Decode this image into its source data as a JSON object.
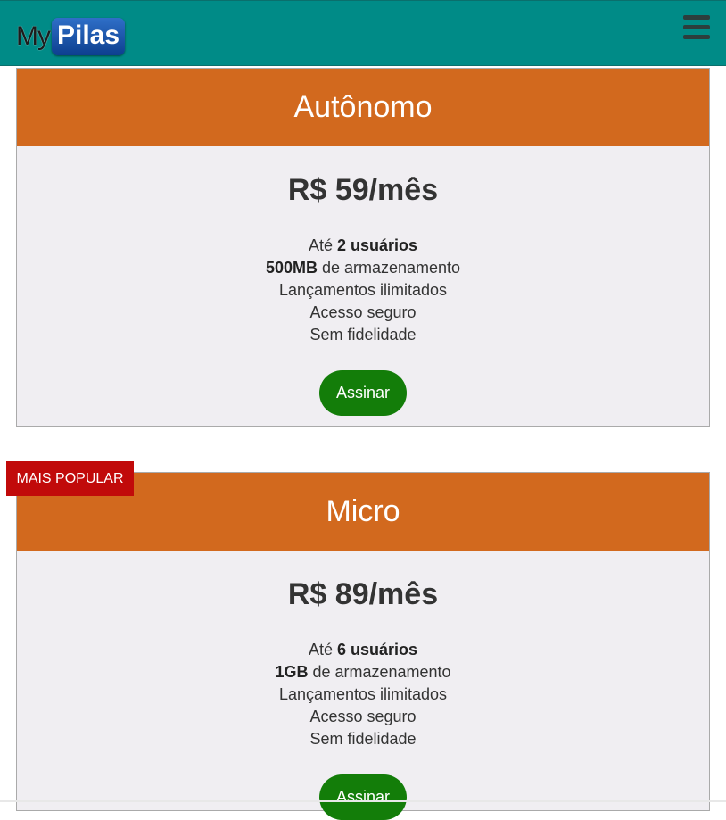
{
  "header": {
    "logo_my": "My",
    "logo_pilas": "Pilas",
    "menu_icon": "hamburger-menu-icon"
  },
  "colors": {
    "navbar": "#008b87",
    "plan_header": "#d2691e",
    "plan_body": "#f0eef2",
    "button": "#137d09",
    "badge": "#c10a0a"
  },
  "plans": [
    {
      "name": "Autônomo",
      "price": "R$ 59/mês",
      "features": {
        "users_prefix": "Até ",
        "users_value": "2 usuários",
        "storage_value": "500MB",
        "storage_suffix": " de armazenamento",
        "line3": "Lançamentos ilimitados",
        "line4": "Acesso seguro",
        "line5": "Sem fidelidade"
      },
      "button_label": "Assinar"
    },
    {
      "name": "Micro",
      "badge": "MAIS POPULAR",
      "price": "R$ 89/mês",
      "features": {
        "users_prefix": "Até ",
        "users_value": "6 usuários",
        "storage_value": "1GB",
        "storage_suffix": " de armazenamento",
        "line3": "Lançamentos ilimitados",
        "line4": "Acesso seguro",
        "line5": "Sem fidelidade"
      },
      "button_label": "Assinar"
    }
  ]
}
